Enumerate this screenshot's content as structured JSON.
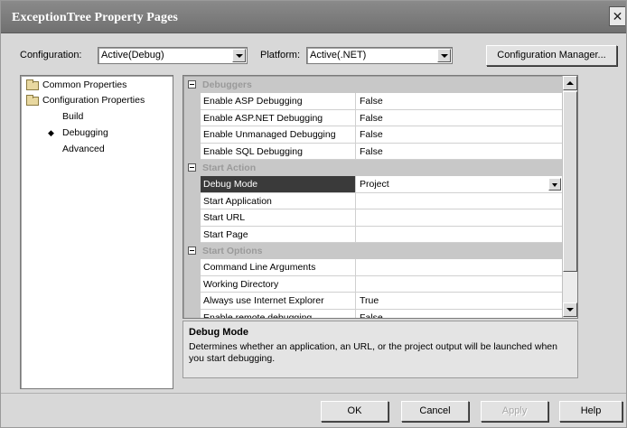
{
  "window": {
    "title": "ExceptionTree Property Pages",
    "close_glyph": "✕"
  },
  "toolbar": {
    "configuration_label": "Configuration:",
    "configuration_value": "Active(Debug)",
    "platform_label": "Platform:",
    "platform_value": "Active(.NET)",
    "config_manager_label": "Configuration Manager..."
  },
  "tree": {
    "items": [
      {
        "label": "Common Properties",
        "icon": "folder-icon"
      },
      {
        "label": "Configuration Properties",
        "icon": "folder-open-icon"
      },
      {
        "label": "Build"
      },
      {
        "label": "Debugging",
        "selected": true,
        "marker": "◆"
      },
      {
        "label": "Advanced"
      }
    ]
  },
  "grid": {
    "rows": [
      {
        "type": "category",
        "name": "Debuggers"
      },
      {
        "type": "property",
        "name": "Enable ASP Debugging",
        "value": "False"
      },
      {
        "type": "property",
        "name": "Enable ASP.NET Debugging",
        "value": "False"
      },
      {
        "type": "property",
        "name": "Enable Unmanaged Debugging",
        "value": "False"
      },
      {
        "type": "property",
        "name": "Enable SQL Debugging",
        "value": "False"
      },
      {
        "type": "category",
        "name": "Start Action"
      },
      {
        "type": "property",
        "name": "Debug Mode",
        "value": "Project",
        "selected": true
      },
      {
        "type": "property",
        "name": "Start Application",
        "value": ""
      },
      {
        "type": "property",
        "name": "Start URL",
        "value": ""
      },
      {
        "type": "property",
        "name": "Start Page",
        "value": ""
      },
      {
        "type": "category",
        "name": "Start Options"
      },
      {
        "type": "property",
        "name": "Command Line Arguments",
        "value": ""
      },
      {
        "type": "property",
        "name": "Working Directory",
        "value": ""
      },
      {
        "type": "property",
        "name": "Always use Internet Explorer",
        "value": "True"
      },
      {
        "type": "property",
        "name": "Enable remote debugging",
        "value": "False"
      }
    ]
  },
  "description": {
    "title": "Debug Mode",
    "text": "Determines whether an application, an URL, or the project output will be launched when you start debugging."
  },
  "buttons": {
    "ok": "OK",
    "cancel": "Cancel",
    "apply": "Apply",
    "help": "Help"
  }
}
